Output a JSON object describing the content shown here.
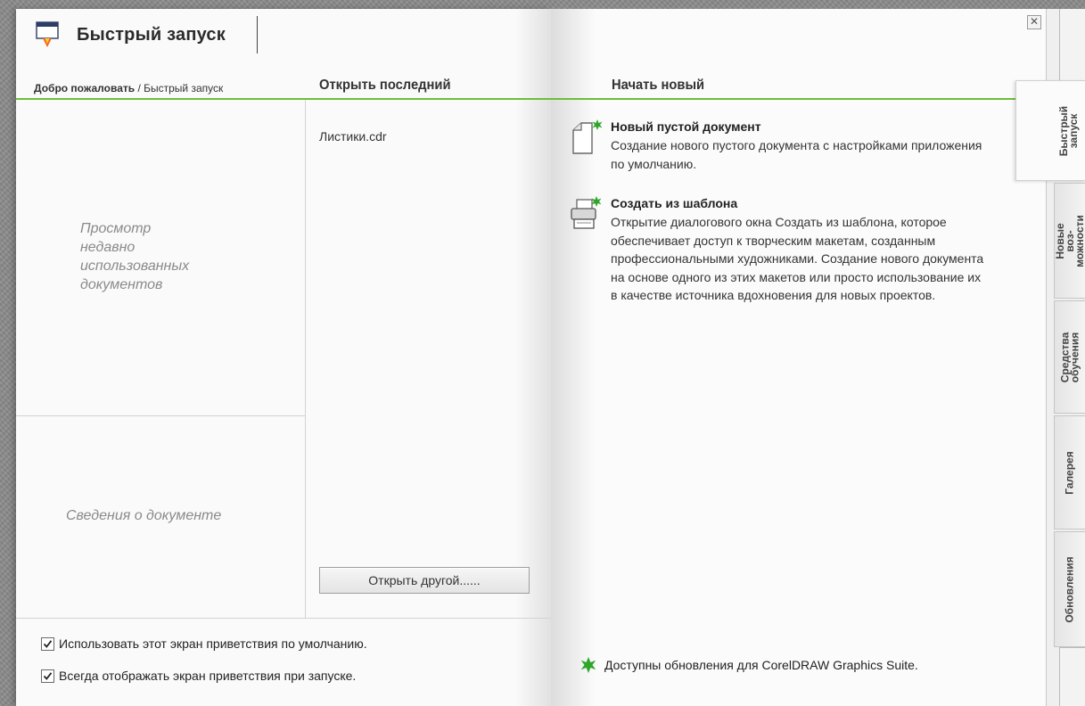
{
  "header": {
    "title": "Быстрый запуск",
    "close_glyph": "✕"
  },
  "breadcrumb": {
    "home": "Добро пожаловать",
    "separator": " / ",
    "current": "Быстрый запуск"
  },
  "recent": {
    "heading": "Открыть последний",
    "items": [
      "Листики.cdr"
    ],
    "preview_placeholder": [
      "Просмотр",
      "недавно",
      "использованных",
      "документов"
    ],
    "info_placeholder": "Сведения о документе",
    "open_other_button": "Открыть другой......"
  },
  "start_new": {
    "heading": "Начать новый",
    "actions": [
      {
        "title": "Новый пустой документ",
        "description": "Создание нового пустого документа с настройками приложения по умолчанию.",
        "icon": "new-document-icon"
      },
      {
        "title": "Создать из шаблона",
        "description": "Открытие диалогового окна Создать из шаблона, которое обеспечивает доступ к творческим макетам, созданным профессиональными художниками. Создание нового документа на основе одного из этих макетов или просто использование их в качестве источника вдохновения для новых проектов.",
        "icon": "template-icon"
      }
    ]
  },
  "side_tabs": [
    {
      "label": "Быстрый запуск",
      "active": true
    },
    {
      "label": "Новые воз- можности",
      "active": false
    },
    {
      "label": "Средства обучения",
      "active": false
    },
    {
      "label": "Галерея",
      "active": false
    },
    {
      "label": "Обновления",
      "active": false
    }
  ],
  "footer": {
    "checkboxes": [
      {
        "label": "Использовать этот экран приветствия по умолчанию.",
        "checked": true
      },
      {
        "label": "Всегда отображать экран приветствия при запуске.",
        "checked": true
      }
    ],
    "update_notice": "Доступны обновления для CorelDRAW Graphics Suite."
  },
  "colors": {
    "accent_green": "#6bbf3a",
    "star_green": "#2fa52a"
  }
}
